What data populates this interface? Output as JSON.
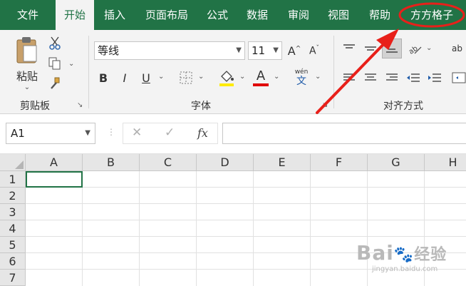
{
  "tabs": [
    "文件",
    "开始",
    "插入",
    "页面布局",
    "公式",
    "数据",
    "审阅",
    "视图",
    "帮助",
    "方方格子"
  ],
  "clipboard": {
    "paste_label": "粘贴",
    "group_label": "剪贴板"
  },
  "font": {
    "name": "等线",
    "size": "11",
    "group_label": "字体",
    "bold": "B",
    "italic": "I",
    "underline": "U",
    "phonetic_top": "wén",
    "phonetic_char": "文",
    "font_color_glyph": "A"
  },
  "alignment": {
    "group_label": "对齐方式",
    "wrap_partial": "ab"
  },
  "namebox": {
    "value": "A1"
  },
  "formula_bar": {
    "cancel_glyph": "✕",
    "enter_glyph": "✓",
    "fx_label": "fx",
    "value": ""
  },
  "columns": [
    "A",
    "B",
    "C",
    "D",
    "E",
    "F",
    "G",
    "H"
  ],
  "rows": [
    "1",
    "2",
    "3",
    "4",
    "5",
    "6",
    "7"
  ],
  "watermark": {
    "brand": "Bai",
    "brand2": "经验",
    "url": "jingyan.baidu.com"
  },
  "colors": {
    "ribbon_green": "#217346",
    "highlight_yellow": "#ffeb00",
    "font_red": "#e00000",
    "annotation_red": "#e8201a"
  }
}
